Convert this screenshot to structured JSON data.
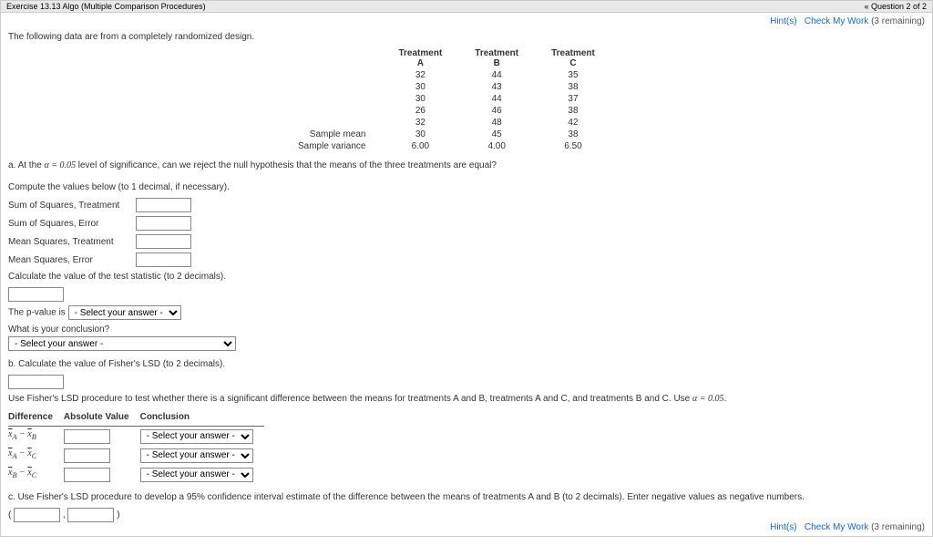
{
  "topbar": {
    "title": "Exercise 13.13 Algo (Multiple Comparison Procedures)",
    "nav": "« Question 2 of 2"
  },
  "links": {
    "hints": "Hint(s)",
    "check": "Check My Work",
    "remaining": "(3 remaining)"
  },
  "intro": "The following data are from a completely randomized design.",
  "table": {
    "head": {
      "t": "Treatment",
      "a": "A",
      "b": "B",
      "c": "C"
    },
    "rows": [
      {
        "a": "32",
        "b": "44",
        "c": "35"
      },
      {
        "a": "30",
        "b": "43",
        "c": "38"
      },
      {
        "a": "30",
        "b": "44",
        "c": "37"
      },
      {
        "a": "26",
        "b": "46",
        "c": "38"
      },
      {
        "a": "32",
        "b": "48",
        "c": "42"
      }
    ],
    "mean": {
      "label": "Sample mean",
      "a": "30",
      "b": "45",
      "c": "38"
    },
    "variance": {
      "label": "Sample variance",
      "a": "6.00",
      "b": "4.00",
      "c": "6.50"
    }
  },
  "a": {
    "prompt_pre": "a. At the ",
    "alpha": "α = 0.05",
    "prompt_post": " level of significance, can we reject the null hypothesis that the means of the three treatments are equal?",
    "compute": "Compute the values below (to 1 decimal, if necessary).",
    "f1": "Sum of Squares, Treatment",
    "f2": "Sum of Squares, Error",
    "f3": "Mean Squares, Treatment",
    "f4": "Mean Squares, Error",
    "calc_stat": "Calculate the value of the test statistic (to 2 decimals).",
    "pvalue_pre": "The p-value is ",
    "select_default": "- Select your answer -",
    "conclusion_q": "What is your conclusion?"
  },
  "b": {
    "prompt": "b. Calculate the value of Fisher's LSD (to 2 decimals).",
    "use_pre": "Use Fisher's LSD procedure to test whether there is a significant difference between the means for treatments A and B, treatments A and C, and treatments B and C. Use ",
    "alpha": "α = 0.05",
    "use_post": ".",
    "th_diff": "Difference",
    "th_abs": "Absolute Value",
    "th_conc": "Conclusion",
    "r1_pre": "x̄",
    "r1_a": "A",
    "r1_minus": " − ",
    "r1_b": "B",
    "r2_a": "A",
    "r2_b": "C",
    "r3_a": "B",
    "r3_b": "C"
  },
  "c": {
    "prompt": "c. Use Fisher's LSD procedure to develop a 95% confidence interval estimate of the difference between the means of treatments A and B (to 2 decimals). Enter negative values as negative numbers.",
    "paren_open": "(",
    "comma": " , ",
    "paren_close": ")"
  }
}
